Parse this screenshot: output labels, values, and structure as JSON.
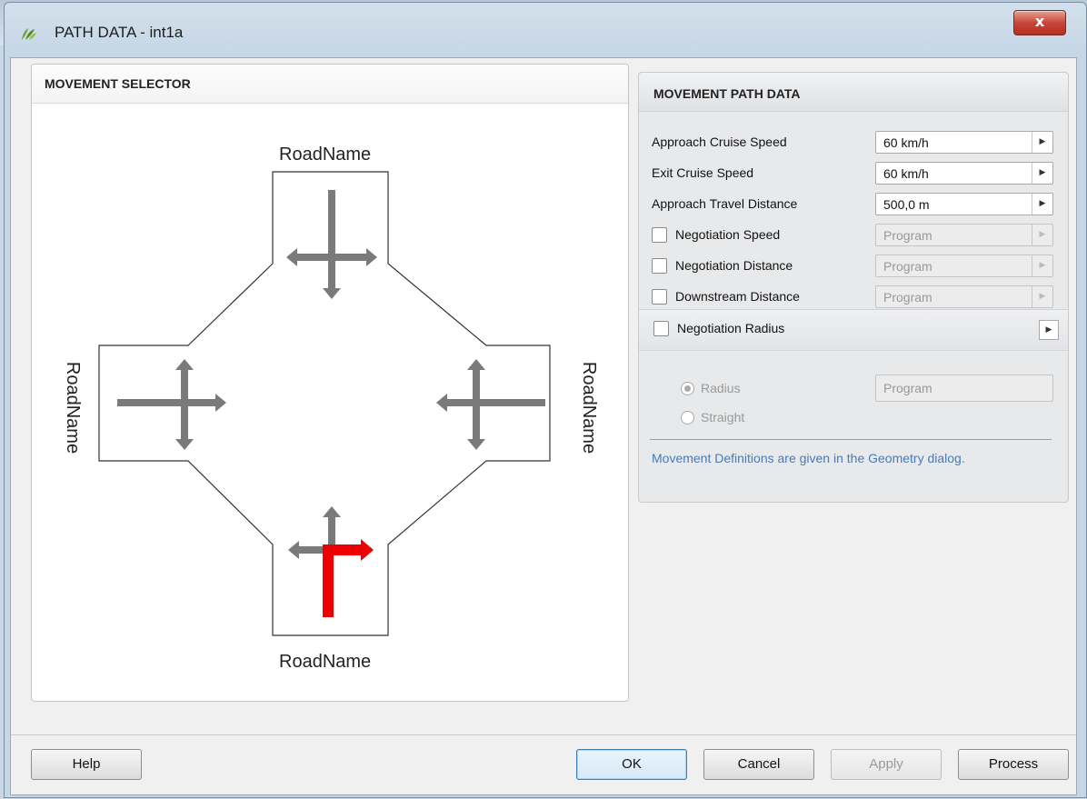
{
  "window": {
    "title": "PATH DATA - int1a",
    "close_label": "x"
  },
  "selector": {
    "header": "MOVEMENT SELECTOR",
    "roads": {
      "north": "RoadName",
      "south": "RoadName",
      "west": "RoadName",
      "east": "RoadName"
    },
    "selected_movement_color": "#ee0000",
    "arrow_color": "#7a7a7a"
  },
  "path_data": {
    "header": "MOVEMENT PATH DATA",
    "rows": [
      {
        "label": "Approach Cruise Speed",
        "value": "60 km/h"
      },
      {
        "label": "Exit Cruise Speed",
        "value": "60 km/h"
      },
      {
        "label": "Approach Travel Distance",
        "value": "500,0 m"
      },
      {
        "label": "Negotiation Speed",
        "value": "Program"
      },
      {
        "label": "Negotiation Distance",
        "value": "Program"
      },
      {
        "label": "Downstream Distance",
        "value": "Program"
      }
    ],
    "negotiation_radius": {
      "label": "Negotiation Radius",
      "radius_label": "Radius",
      "straight_label": "Straight",
      "radius_value": "Program"
    },
    "note": "Movement Definitions are given in the Geometry dialog."
  },
  "buttons": {
    "help": "Help",
    "ok": "OK",
    "cancel": "Cancel",
    "apply": "Apply",
    "process": "Process"
  }
}
